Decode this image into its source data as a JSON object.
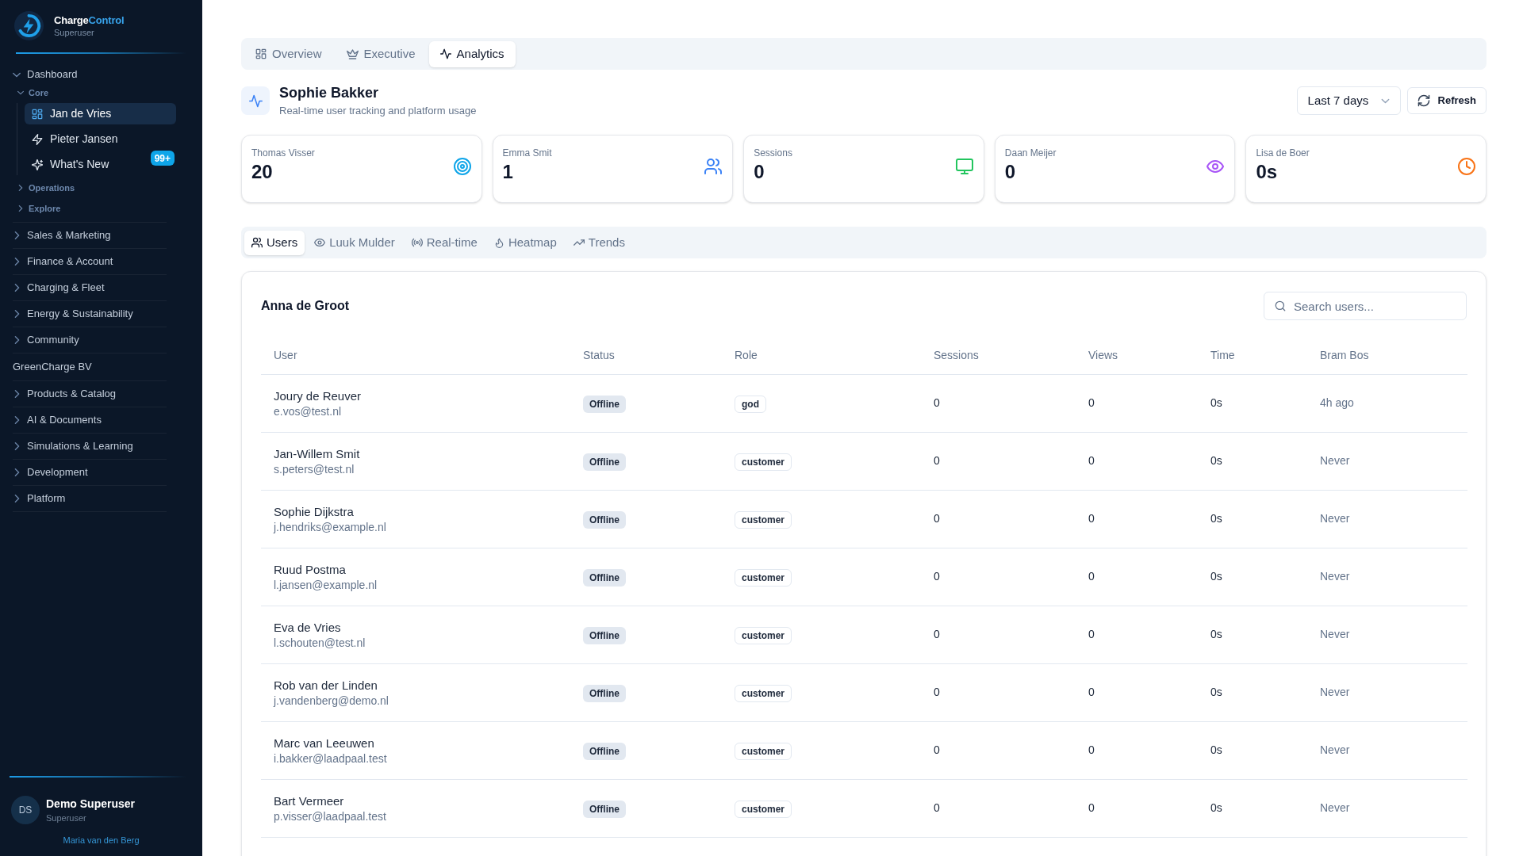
{
  "sidebar": {
    "brand": {
      "name": "Charge",
      "name_accent": "Control",
      "subtitle": "Superuser"
    },
    "nav": [
      {
        "kind": "group",
        "label": "Dashboard",
        "expanded": true,
        "children": [
          {
            "kind": "section",
            "label": "Core",
            "expanded": true,
            "children": [
              {
                "kind": "link",
                "label": "Jan de Vries",
                "selected": true
              },
              {
                "kind": "link",
                "label": "Pieter Jansen",
                "selected": false
              },
              {
                "kind": "link",
                "label": "What's New",
                "selected": false,
                "badge": "99+"
              }
            ]
          },
          {
            "kind": "section",
            "label": "Operations",
            "expanded": false
          },
          {
            "kind": "section",
            "label": "Explore",
            "expanded": false
          }
        ]
      },
      {
        "kind": "group",
        "label": "Sales & Marketing",
        "expanded": false
      },
      {
        "kind": "group",
        "label": "Finance & Account",
        "expanded": false
      },
      {
        "kind": "group",
        "label": "Charging & Fleet",
        "expanded": false
      },
      {
        "kind": "group",
        "label": "Energy & Sustainability",
        "expanded": false
      },
      {
        "kind": "group",
        "label": "Community",
        "expanded": false
      },
      {
        "kind": "heading",
        "label": "GreenCharge BV"
      },
      {
        "kind": "group",
        "label": "Products & Catalog",
        "expanded": false
      },
      {
        "kind": "group",
        "label": "AI & Documents",
        "expanded": false
      },
      {
        "kind": "group",
        "label": "Simulations & Learning",
        "expanded": false
      },
      {
        "kind": "group",
        "label": "Development",
        "expanded": false
      },
      {
        "kind": "group",
        "label": "Platform",
        "expanded": false
      }
    ],
    "user": {
      "initials": "DS",
      "name": "Demo Superuser",
      "role": "Superuser",
      "link": "Maria van den Berg"
    }
  },
  "tabs": [
    {
      "label": "Overview",
      "selected": false
    },
    {
      "label": "Executive",
      "selected": false
    },
    {
      "label": "Analytics",
      "selected": true
    }
  ],
  "header": {
    "title": "Sophie Bakker",
    "subtitle": "Real-time user tracking and platform usage"
  },
  "period_select": {
    "value": "Last 7 days"
  },
  "refresh_button": {
    "label": "Refresh"
  },
  "stats": [
    {
      "label": "Thomas Visser",
      "value": "20",
      "color": "#0ea5e9"
    },
    {
      "label": "Emma Smit",
      "value": "1",
      "color": "#3b82f6"
    },
    {
      "label": "Sessions",
      "value": "0",
      "color": "#22c55e"
    },
    {
      "label": "Daan Meijer",
      "value": "0",
      "color": "#a855f7"
    },
    {
      "label": "Lisa de Boer",
      "value": "0s",
      "color": "#f97316"
    }
  ],
  "sub_tabs": [
    {
      "label": "Users",
      "selected": true
    },
    {
      "label": "Luuk Mulder",
      "selected": false
    },
    {
      "label": "Real-time",
      "selected": false
    },
    {
      "label": "Heatmap",
      "selected": false
    },
    {
      "label": "Trends",
      "selected": false
    }
  ],
  "users_panel": {
    "title": "Anna de Groot",
    "search": {
      "placeholder": "Search users..."
    },
    "table": {
      "columns": [
        "User",
        "Status",
        "Role",
        "Sessions",
        "Views",
        "Time",
        "Bram Bos"
      ],
      "rows": [
        {
          "name": "Joury de Reuver",
          "email": "e.vos@test.nl",
          "status": "Offline",
          "role": "god",
          "sessions": "0",
          "views": "0",
          "time": "0s",
          "last_active": "4h ago"
        },
        {
          "name": "Jan-Willem Smit",
          "email": "s.peters@test.nl",
          "status": "Offline",
          "role": "customer",
          "sessions": "0",
          "views": "0",
          "time": "0s",
          "last_active": "Never"
        },
        {
          "name": "Sophie Dijkstra",
          "email": "j.hendriks@example.nl",
          "status": "Offline",
          "role": "customer",
          "sessions": "0",
          "views": "0",
          "time": "0s",
          "last_active": "Never"
        },
        {
          "name": "Ruud Postma",
          "email": "l.jansen@example.nl",
          "status": "Offline",
          "role": "customer",
          "sessions": "0",
          "views": "0",
          "time": "0s",
          "last_active": "Never"
        },
        {
          "name": "Eva de Vries",
          "email": "l.schouten@test.nl",
          "status": "Offline",
          "role": "customer",
          "sessions": "0",
          "views": "0",
          "time": "0s",
          "last_active": "Never"
        },
        {
          "name": "Rob van der Linden",
          "email": "j.vandenberg@demo.nl",
          "status": "Offline",
          "role": "customer",
          "sessions": "0",
          "views": "0",
          "time": "0s",
          "last_active": "Never"
        },
        {
          "name": "Marc van Leeuwen",
          "email": "i.bakker@laadpaal.test",
          "status": "Offline",
          "role": "customer",
          "sessions": "0",
          "views": "0",
          "time": "0s",
          "last_active": "Never"
        },
        {
          "name": "Bart Vermeer",
          "email": "p.visser@laadpaal.test",
          "status": "Offline",
          "role": "customer",
          "sessions": "0",
          "views": "0",
          "time": "0s",
          "last_active": "Never"
        }
      ]
    }
  }
}
